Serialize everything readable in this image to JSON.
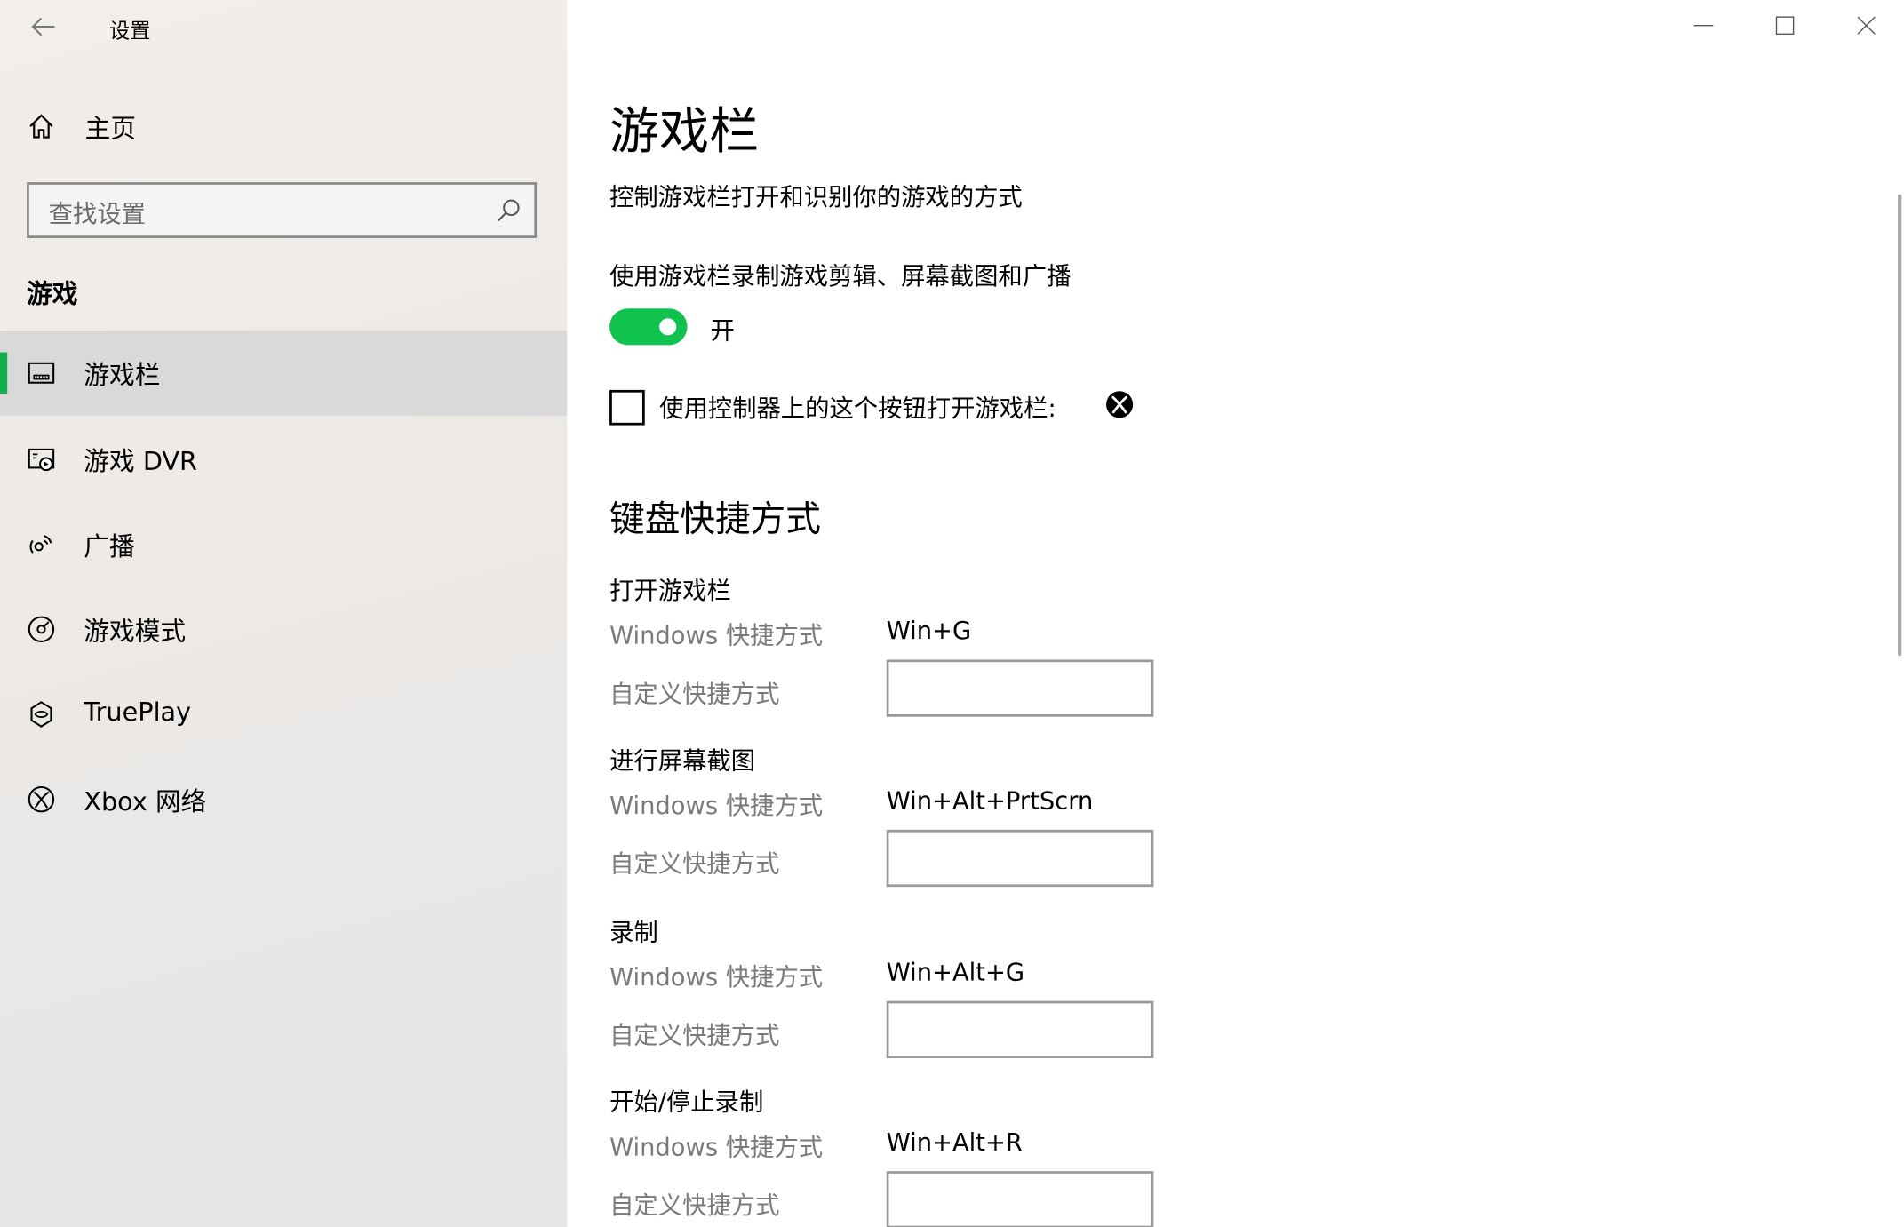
{
  "window": {
    "app_title": "设置",
    "controls": [
      "minimize-icon",
      "maximize-icon",
      "close-icon"
    ]
  },
  "sidebar": {
    "home_label": "主页",
    "search_placeholder": "查找设置",
    "section_title": "游戏",
    "items": [
      {
        "label": "游戏栏",
        "icon": "game-bar-icon",
        "active": true
      },
      {
        "label": "游戏 DVR",
        "icon": "game-dvr-icon",
        "active": false
      },
      {
        "label": "广播",
        "icon": "broadcast-icon",
        "active": false
      },
      {
        "label": "游戏模式",
        "icon": "game-mode-icon",
        "active": false
      },
      {
        "label": "TruePlay",
        "icon": "trueplay-icon",
        "active": false
      },
      {
        "label": "Xbox 网络",
        "icon": "xbox-icon",
        "active": false
      }
    ],
    "accent_color": "#10b04f"
  },
  "main": {
    "title": "游戏栏",
    "subtitle": "控制游戏栏打开和识别你的游戏的方式",
    "record_toggle": {
      "description": "使用游戏栏录制游戏剪辑、屏幕截图和广播",
      "state_label": "开",
      "on": true,
      "color": "#10c34f"
    },
    "controller_checkbox": {
      "label": "使用控制器上的这个按钮打开游戏栏:",
      "checked": false,
      "icon": "xbox-icon"
    },
    "keyboard_section_title": "键盘快捷方式",
    "shortcut_groups": [
      {
        "title": "打开游戏栏",
        "windows_label": "Windows 快捷方式",
        "windows_value": "Win+G",
        "custom_label": "自定义快捷方式",
        "custom_value": ""
      },
      {
        "title": "进行屏幕截图",
        "windows_label": "Windows 快捷方式",
        "windows_value": "Win+Alt+PrtScrn",
        "custom_label": "自定义快捷方式",
        "custom_value": ""
      },
      {
        "title": "录制",
        "windows_label": "Windows 快捷方式",
        "windows_value": "Win+Alt+G",
        "custom_label": "自定义快捷方式",
        "custom_value": ""
      },
      {
        "title": "开始/停止录制",
        "windows_label": "Windows 快捷方式",
        "windows_value": "Win+Alt+R",
        "custom_label": "自定义快捷方式",
        "custom_value": ""
      }
    ]
  }
}
